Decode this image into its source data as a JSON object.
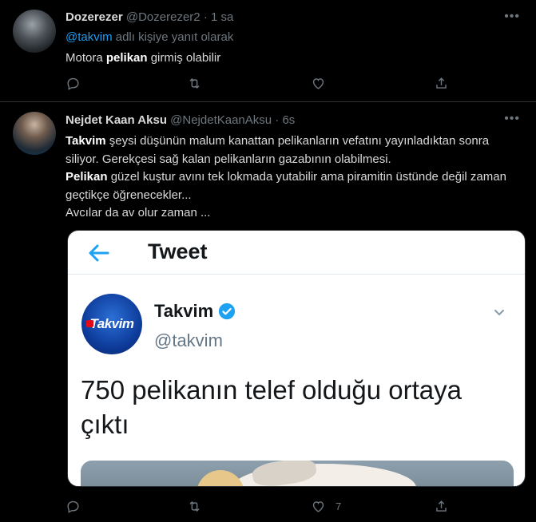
{
  "tweets": [
    {
      "name": "Dozerezer",
      "handle": "@Dozerezer2",
      "dot": "·",
      "time": "1 sa",
      "reply_to_mention": "@takvim",
      "reply_to_suffix": " adlı kişiye yanıt olarak",
      "body": {
        "pre": "Motora ",
        "bold": "pelikan",
        "post": " girmiş olabilir"
      },
      "actions": {
        "reply_count": "",
        "retweet_count": "",
        "like_count": ""
      }
    },
    {
      "name": "Nejdet Kaan Aksu",
      "handle": "@NejdetKaanAksu",
      "dot": "·",
      "time": "6s",
      "body": {
        "p1_bold": "Takvim",
        "p1_rest": " şeysi düşünün malum kanattan pelikanların vefatını yayınladıktan sonra siliyor. Gerekçesi sağ kalan pelikanların gazabının olabilmesi.",
        "p2_bold": "Pelikan",
        "p2_rest": " güzel kuştur avını tek lokmada yutabilir ama piramitin üstünde değil zaman geçtikçe öğrenecekler...",
        "p3": "Avcılar da av olur zaman ..."
      },
      "embed": {
        "title": "Tweet",
        "logo_text": "Takvim",
        "account_name": "Takvim",
        "account_handle": "@takvim",
        "headline": "750 pelikanın telef olduğu ortaya çıktı"
      },
      "actions": {
        "reply_count": "",
        "retweet_count": "",
        "like_count": "7"
      }
    }
  ],
  "colors": {
    "background": "#000000",
    "text": "#d9d9d9",
    "muted": "#6e767d",
    "accent": "#1d9bf0",
    "verified": "#1da1f2"
  },
  "icons": {
    "reply": "speech-bubble",
    "retweet": "retweet-arrows",
    "like": "heart-outline",
    "share": "share-upload",
    "more": "ellipsis",
    "back": "arrow-left",
    "verified": "verified-badge",
    "chevron": "chevron-down"
  }
}
